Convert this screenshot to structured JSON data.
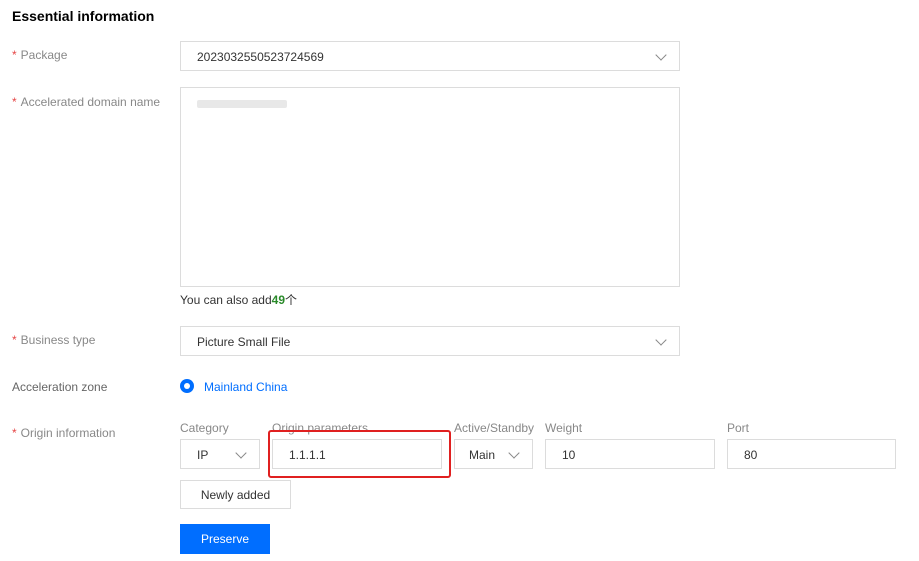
{
  "section": {
    "title": "Essential information"
  },
  "package": {
    "label": "Package",
    "value": "2023032550523724569"
  },
  "domain": {
    "label": "Accelerated domain name",
    "hint_prefix": "You can also add",
    "hint_count": "49",
    "hint_suffix": "个"
  },
  "business": {
    "label": "Business type",
    "value": "Picture Small File"
  },
  "zone": {
    "label": "Acceleration zone",
    "option": "Mainland China"
  },
  "origin": {
    "label": "Origin information",
    "columns": {
      "category": "Category",
      "params": "Origin parameters",
      "active": "Active/Standby",
      "weight": "Weight",
      "port": "Port"
    },
    "category_value": "IP",
    "params_value": "1.1.1.1",
    "active_value": "Main",
    "weight_value": "10",
    "port_value": "80",
    "add_button": "Newly added"
  },
  "actions": {
    "submit": "Preserve"
  },
  "colors": {
    "accent": "#006eff",
    "required": "#e54545",
    "highlight": "#e02020",
    "count": "#2a8a2a"
  },
  "icons": {
    "dropdown": "chevron-down-icon",
    "radio": "radio-selected-icon"
  }
}
